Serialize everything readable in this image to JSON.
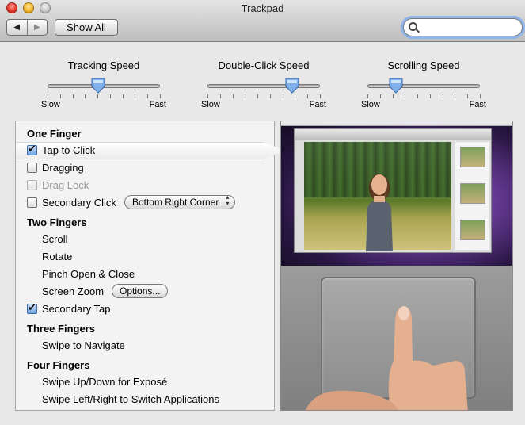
{
  "window": {
    "title": "Trackpad"
  },
  "toolbar": {
    "back_glyph": "◀",
    "forward_glyph": "▶",
    "show_all": "Show All",
    "search": {
      "value": "",
      "placeholder": ""
    }
  },
  "sliders": [
    {
      "label": "Tracking Speed",
      "min_label": "Slow",
      "max_label": "Fast",
      "level": 0.45
    },
    {
      "label": "Double-Click Speed",
      "min_label": "Slow",
      "max_label": "Fast",
      "level": 0.75
    },
    {
      "label": "Scrolling Speed",
      "min_label": "Slow",
      "max_label": "Fast",
      "level": 0.25
    }
  ],
  "one_finger": {
    "heading": "One Finger",
    "tap_to_click": {
      "label": "Tap to Click",
      "checked": true
    },
    "dragging": {
      "label": "Dragging",
      "checked": false
    },
    "drag_lock": {
      "label": "Drag Lock",
      "checked": false,
      "disabled": true
    },
    "secondary_click": {
      "label": "Secondary Click",
      "checked": false,
      "option": "Bottom Right Corner"
    }
  },
  "two_fingers": {
    "heading": "Two Fingers",
    "scroll": "Scroll",
    "rotate": "Rotate",
    "pinch": "Pinch Open & Close",
    "screen_zoom": "Screen Zoom",
    "options_button": "Options...",
    "secondary_tap": {
      "label": "Secondary Tap",
      "checked": true
    }
  },
  "three_fingers": {
    "heading": "Three Fingers",
    "swipe_navigate": "Swipe to Navigate"
  },
  "four_fingers": {
    "heading": "Four Fingers",
    "swipe_expose": "Swipe Up/Down for Exposé",
    "swipe_switch": "Swipe Left/Right to Switch Applications"
  },
  "colors": {
    "window_bg": "#e8e8e8",
    "focus_ring": "#8fb5e8",
    "checkbox_checked": "#6fa4e2"
  }
}
